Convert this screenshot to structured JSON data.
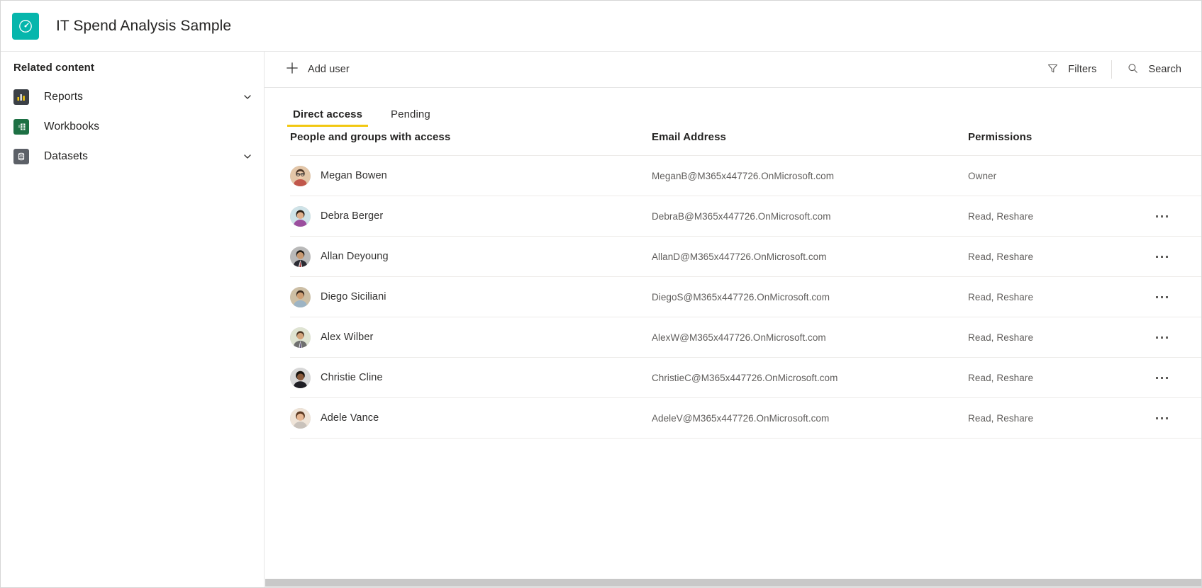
{
  "header": {
    "title": "IT Spend Analysis Sample",
    "icon": "gauge-icon",
    "icon_color": "#06b6ac"
  },
  "sidebar": {
    "heading": "Related content",
    "items": [
      {
        "label": "Reports",
        "icon": "bar-chart-icon",
        "icon_color": "#3b4046",
        "has_chevron": true
      },
      {
        "label": "Workbooks",
        "icon": "excel-workbook-icon",
        "icon_color": "#1d7044",
        "has_chevron": false
      },
      {
        "label": "Datasets",
        "icon": "database-icon",
        "icon_color": "#5c6067",
        "has_chevron": true
      }
    ]
  },
  "toolbar": {
    "add_user_label": "Add user",
    "add_user_icon": "plus-icon",
    "filters_label": "Filters",
    "filters_icon": "funnel-icon",
    "search_label": "Search",
    "search_icon": "search-icon"
  },
  "tabs": [
    {
      "label": "Direct access",
      "active": true
    },
    {
      "label": "Pending",
      "active": false
    }
  ],
  "table": {
    "columns": [
      "People and groups with access",
      "Email Address",
      "Permissions"
    ],
    "rows": [
      {
        "name": "Megan Bowen",
        "email": "MeganB@M365x447726.OnMicrosoft.com",
        "permission": "Owner",
        "has_menu": false
      },
      {
        "name": "Debra Berger",
        "email": "DebraB@M365x447726.OnMicrosoft.com",
        "permission": "Read, Reshare",
        "has_menu": true
      },
      {
        "name": "Allan Deyoung",
        "email": "AllanD@M365x447726.OnMicrosoft.com",
        "permission": "Read, Reshare",
        "has_menu": true
      },
      {
        "name": "Diego Siciliani",
        "email": "DiegoS@M365x447726.OnMicrosoft.com",
        "permission": "Read, Reshare",
        "has_menu": true
      },
      {
        "name": "Alex Wilber",
        "email": "AlexW@M365x447726.OnMicrosoft.com",
        "permission": "Read, Reshare",
        "has_menu": true
      },
      {
        "name": "Christie Cline",
        "email": "ChristieC@M365x447726.OnMicrosoft.com",
        "permission": "Read, Reshare",
        "has_menu": true
      },
      {
        "name": "Adele Vance",
        "email": "AdeleV@M365x447726.OnMicrosoft.com",
        "permission": "Read, Reshare",
        "has_menu": true
      }
    ]
  },
  "colors": {
    "accent_tab_underline": "#f2c811",
    "app_icon": "#06b6ac",
    "text_primary": "#252423",
    "text_secondary": "#605e5c",
    "border": "#edebe9"
  }
}
